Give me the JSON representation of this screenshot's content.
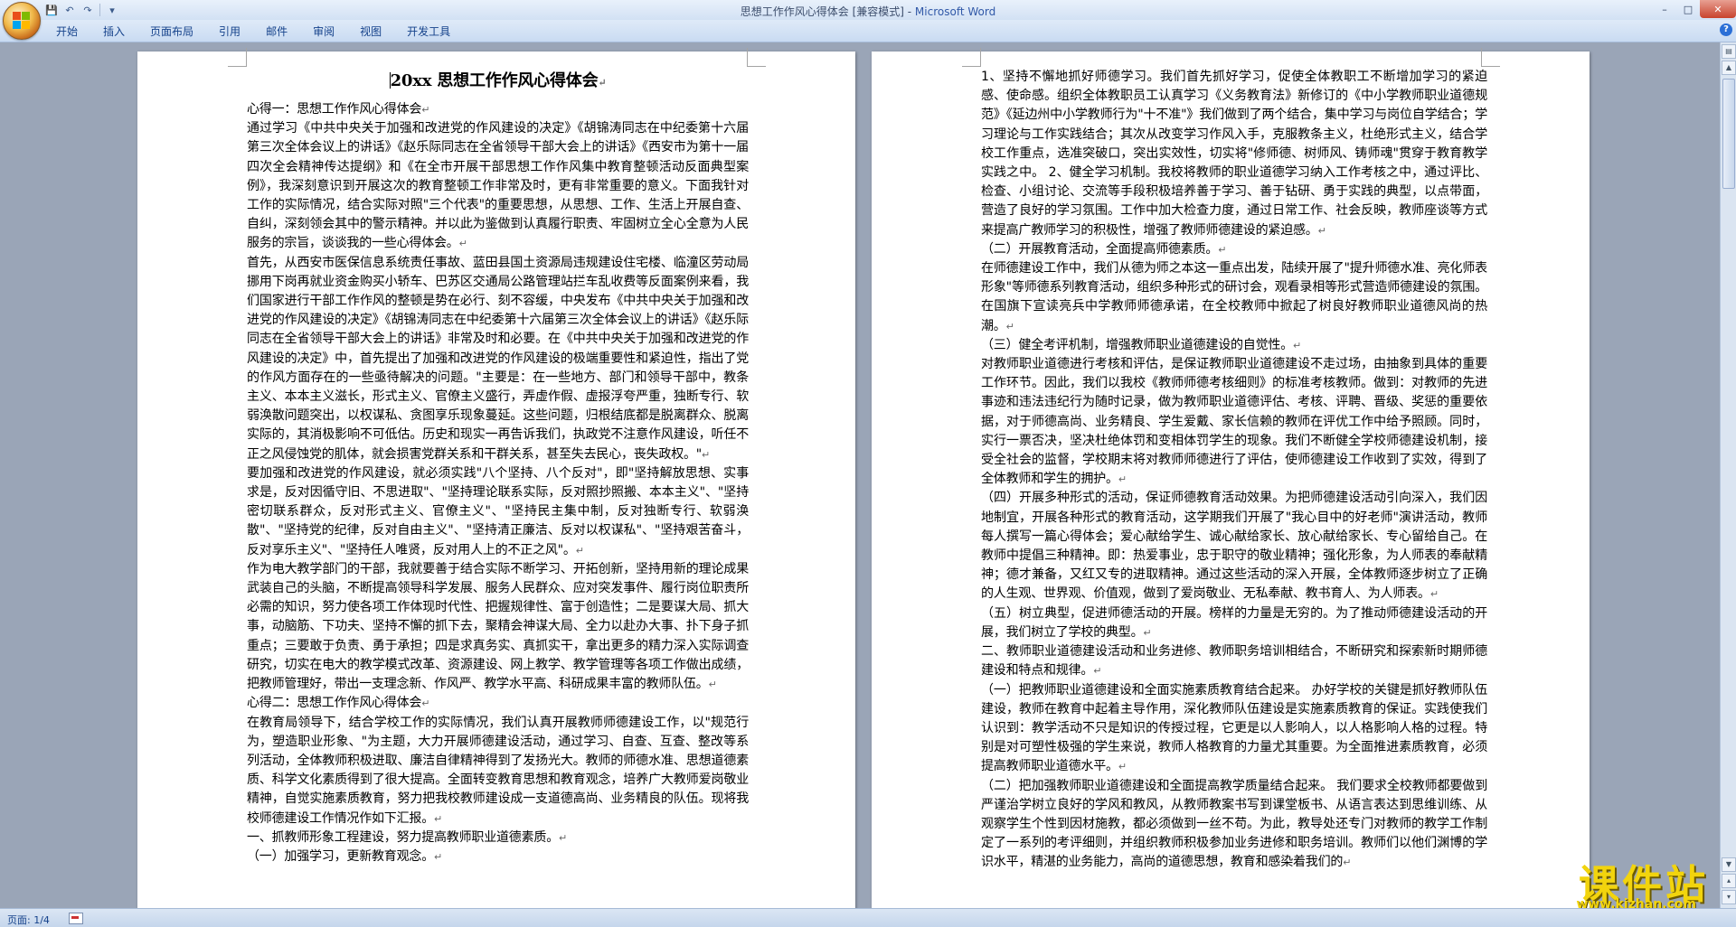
{
  "window": {
    "doc_title": "思想工作作风心得体会 [兼容模式] - ",
    "app_name": "Microsoft Word"
  },
  "quick_access": [
    "save-icon",
    "undo-icon",
    "redo-icon",
    "customize-icon"
  ],
  "ribbon_tabs": [
    "开始",
    "插入",
    "页面布局",
    "引用",
    "邮件",
    "审阅",
    "视图",
    "开发工具"
  ],
  "status": {
    "page": "页面: 1/4"
  },
  "watermark": {
    "main": "课件站",
    "url": "www.kjzhan.com"
  },
  "page1": {
    "title": "20xx 思想工作作风心得体会",
    "paragraphs": [
      "心得一：思想工作作风心得体会",
      "通过学习《中共中央关于加强和改进党的作风建设的决定》《胡锦涛同志在中纪委第十六届第三次全体会议上的讲话》《赵乐际同志在全省领导干部大会上的讲话》《西安市为第十一届四次全会精神传达提纲》和《在全市开展干部思想工作作风集中教育整顿活动反面典型案例》，我深刻意识到开展这次的教育整顿工作非常及时，更有非常重要的意义。下面我针对工作的实际情况，结合实际对照\"三个代表\"的重要思想，从思想、工作、生活上开展自查、自纠，深刻领会其中的警示精神。并以此为鉴做到认真履行职责、牢固树立全心全意为人民服务的宗旨，谈谈我的一些心得体会。",
      "首先，从西安市医保信息系统责任事故、蓝田县国土资源局违规建设住宅楼、临潼区劳动局挪用下岗再就业资金购买小轿车、巴苏区交通局公路管理站拦车乱收费等反面案例来看，我们国家进行干部工作作风的整顿是势在必行、刻不容缓，中央发布《中共中央关于加强和改进党的作风建设的决定》《胡锦涛同志在中纪委第十六届第三次全体会议上的讲话》《赵乐际同志在全省领导干部大会上的讲话》非常及时和必要。在《中共中央关于加强和改进党的作风建设的决定》中，首先提出了加强和改进党的作风建设的极端重要性和紧迫性，指出了党的作风方面存在的一些亟待解决的问题。\"主要是：在一些地方、部门和领导干部中，教条主义、本本主义滋长，形式主义、官僚主义盛行，弄虚作假、虚报浮夸严重，独断专行、软弱涣散问题突出，以权谋私、贪图享乐现象蔓延。这些问题，归根结底都是脱离群众、脱离实际的，其消极影响不可低估。历史和现实一再告诉我们，执政党不注意作风建设，听任不正之风侵蚀党的肌体，就会损害党群关系和干群关系，甚至失去民心，丧失政权。\"",
      "要加强和改进党的作风建设，就必须实践\"八个坚持、八个反对\"，即\"坚持解放思想、实事求是，反对因循守旧、不思进取\"、\"坚持理论联系实际，反对照抄照搬、本本主义\"、\"坚持密切联系群众，反对形式主义、官僚主义\"、\"坚持民主集中制，反对独断专行、软弱涣散\"、\"坚持党的纪律，反对自由主义\"、\"坚持清正廉洁、反对以权谋私\"、\"坚持艰苦奋斗，反对享乐主义\"、\"坚持任人唯贤，反对用人上的不正之风\"。",
      "作为电大教学部门的干部，我就要善于结合实际不断学习、开拓创新，坚持用新的理论成果武装自己的头脑，不断提高领导科学发展、服务人民群众、应对突发事件、履行岗位职责所必需的知识，努力使各项工作体现时代性、把握规律性、富于创造性；二是要谋大局、抓大事，动脑筋、下功夫、坚持不懈的抓下去，聚精会神谋大局、全力以赴办大事、扑下身子抓重点；三要敢于负责、勇于承担；四是求真务实、真抓实干，拿出更多的精力深入实际调查研究，切实在电大的教学模式改革、资源建设、网上教学、教学管理等各项工作做出成绩，把教师管理好，带出一支理念新、作风严、教学水平高、科研成果丰富的教师队伍。",
      "心得二：思想工作作风心得体会",
      "在教育局领导下，结合学校工作的实际情况，我们认真开展教师师德建设工作，以\"规范行为，塑造职业形象、\"为主题，大力开展师德建设活动，通过学习、自查、互查、整改等系列活动，全体教师积极进取、廉洁自律精神得到了发扬光大。教师的师德水准、思想道德素质、科学文化素质得到了很大提高。全面转变教育思想和教育观念，培养广大教师爱岗敬业精神，自觉实施素质教育，努力把我校教师建设成一支道德高尚、业务精良的队伍。现将我校师德建设工作情况作如下汇报。",
      "一、抓教师形象工程建设，努力提高教师职业道德素质。",
      "（一）加强学习，更新教育观念。"
    ]
  },
  "page2": {
    "paragraphs": [
      "1、坚持不懈地抓好师德学习。我们首先抓好学习，促使全体教职工不断增加学习的紧迫感、使命感。组织全体教职员工认真学习《义务教育法》新修订的《中小学教师职业道德规范》《延边州中小学教师行为\"十不准\"》我们做到了两个结合，集中学习与岗位自学结合；学习理论与工作实践结合；其次从改变学习作风入手，克服教条主义，杜绝形式主义，结合学校工作重点，选准突破口，突出实效性，切实将\"修师德、树师风、铸师魂\"贯穿于教育教学实践之中。 2、健全学习机制。我校将教师的职业道德学习纳入工作考核之中，通过评比、检查、小组讨论、交流等手段积极培养善于学习、善于钻研、勇于实践的典型，以点带面，营造了良好的学习氛围。工作中加大检查力度，通过日常工作、社会反映，教师座谈等方式来提高广教师学习的积极性，增强了教师师德建设的紧迫感。",
      "（二）开展教育活动，全面提高师德素质。",
      "在师德建设工作中，我们从德为师之本这一重点出发，陆续开展了\"提升师德水准、亮化师表形象\"等师德系列教育活动，组织多种形式的研讨会，观看录相等形式营造师德建设的氛围。在国旗下宣读亮兵中学教师师德承诺，在全校教师中掀起了树良好教师职业道德风尚的热潮。",
      "（三）健全考评机制，增强教师职业道德建设的自觉性。",
      "对教师职业道德进行考核和评估，是保证教师职业道德建设不走过场，由抽象到具体的重要工作环节。因此，我们以我校《教师师德考核细则》的标准考核教师。做到：对教师的先进事迹和违法违纪行为随时记录，做为教师职业道德评估、考核、评聘、晋级、奖惩的重要依据，对于师德高尚、业务精良、学生爱戴、家长信赖的教师在评优工作中给予照顾。同时，实行一票否决，坚决杜绝体罚和变相体罚学生的现象。我们不断健全学校师德建设机制，接受全社会的监督，学校期末将对教师师德进行了评估，使师德建设工作收到了实效，得到了全体教师和学生的拥护。",
      "（四）开展多种形式的活动，保证师德教育活动效果。为把师德建设活动引向深入，我们因地制宜，开展各种形式的教育活动，这学期我们开展了\"我心目中的好老师\"演讲活动，教师每人撰写一篇心得体会；爱心献给学生、诚心献给家长、放心献给家长、专心留给自己。在教师中提倡三种精神。即：热爱事业，忠于职守的敬业精神；强化形象，为人师表的奉献精神；德才兼备，又红又专的进取精神。通过这些活动的深入开展，全体教师逐步树立了正确的人生观、世界观、价值观，做到了爱岗敬业、无私奉献、教书育人、为人师表。",
      "（五）树立典型，促进师德活动的开展。榜样的力量是无穷的。为了推动师德建设活动的开展，我们树立了学校的典型。",
      "二、教师职业道德建设活动和业务进修、教师职务培训相结合，不断研究和探索新时期师德建设和特点和规律。",
      "（一）把教师职业道德建设和全面实施素质教育结合起来。 办好学校的关键是抓好教师队伍建设，教师在教育中起着主导作用，深化教师队伍建设是实施素质教育的保证。实践使我们认识到：教学活动不只是知识的传授过程，它更是以人影响人，以人格影响人格的过程。特别是对可塑性极强的学生来说，教师人格教育的力量尤其重要。为全面推进素质教育，必须提高教师职业道德水平。",
      "（二）把加强教师职业道德建设和全面提高教学质量结合起来。 我们要求全校教师都要做到严谨治学树立良好的学风和教风，从教师教案书写到课堂板书、从语言表达到思维训练、从观察学生个性到因材施教，都必须做到一丝不苟。为此，教导处还专门对教师的教学工作制定了一系列的考评细则，并组织教师积极参加业务进修和职务培训。教师们以他们渊博的学识水平，精湛的业务能力，高尚的道德思想，教育和感染着我们的"
    ]
  }
}
